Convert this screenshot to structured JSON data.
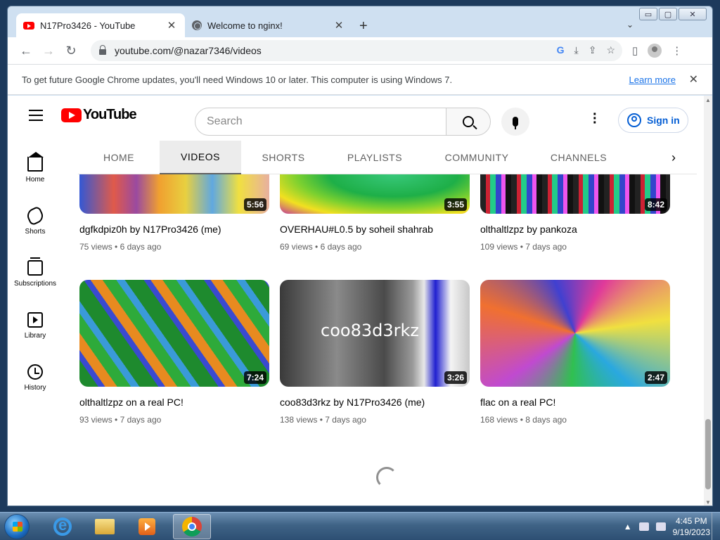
{
  "window": {
    "minimize": "▭",
    "maximize": "▢",
    "close": "✕"
  },
  "tabs": [
    {
      "title": "N17Pro3426 - YouTube",
      "close": "✕"
    },
    {
      "title": "Welcome to nginx!",
      "close": "✕"
    }
  ],
  "new_tab": "+",
  "tab_search": "⌄",
  "toolbar": {
    "back": "←",
    "forward": "→",
    "reload": "↻",
    "url": "youtube.com/@nazar7346/videos",
    "menu": "⋮"
  },
  "infobar": {
    "message": "To get future Google Chrome updates, you'll need Windows 10 or later. This computer is using Windows 7.",
    "link": "Learn more",
    "close": "✕"
  },
  "youtube": {
    "logo_text": "YouTube",
    "search_placeholder": "Search",
    "signin": "Sign in",
    "channel_tabs": [
      "HOME",
      "VIDEOS",
      "SHORTS",
      "PLAYLISTS",
      "COMMUNITY",
      "CHANNELS"
    ],
    "tabs_next": "›",
    "sidebar": [
      "Home",
      "Shorts",
      "Subscriptions",
      "Library",
      "History"
    ]
  },
  "videos": [
    {
      "title": "dgfkdpiz0h by N17Pro3426 (me)",
      "duration": "5:56",
      "views": "75 views",
      "age": "6 days ago"
    },
    {
      "title": "OVERHAU#L0.5 by soheil shahrab",
      "duration": "3:55",
      "views": "69 views",
      "age": "6 days ago"
    },
    {
      "title": "olthaltlzpz by pankoza",
      "duration": "8:42",
      "views": "109 views",
      "age": "7 days ago"
    },
    {
      "title": "olthaltlzpz on a real PC!",
      "duration": "7:24",
      "views": "93 views",
      "age": "7 days ago"
    },
    {
      "title": "coo83d3rkz by N17Pro3426 (me)",
      "duration": "3:26",
      "views": "138 views",
      "age": "7 days ago",
      "thumb_text": "coo83d3rkz"
    },
    {
      "title": "flac on a real PC!",
      "duration": "2:47",
      "views": "168 views",
      "age": "8 days ago"
    }
  ],
  "meta_sep": "•",
  "taskbar": {
    "time": "4:45 PM",
    "date": "9/19/2023"
  }
}
